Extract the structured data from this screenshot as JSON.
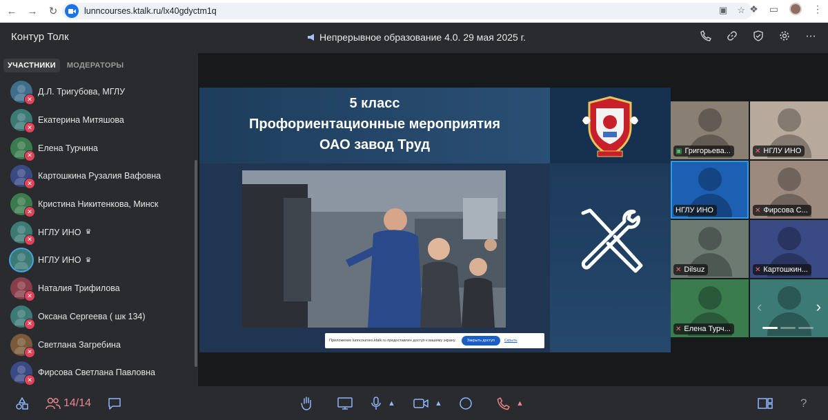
{
  "browser": {
    "url": "lunncourses.ktalk.ru/lx40gdyctm1q"
  },
  "app": {
    "title": "Контур Толк",
    "meeting_title": "Непрерывное образование 4.0. 29 мая 2025 г."
  },
  "sidebar": {
    "tabs": [
      {
        "label": "УЧАСТНИКИ",
        "active": true
      },
      {
        "label": "МОДЕРАТОРЫ",
        "active": false
      }
    ],
    "participants": [
      {
        "name": "Д.Л. Тригубова, МГЛУ",
        "color": "#3f6e8c",
        "muted": true,
        "moderator": false
      },
      {
        "name": "Екатерина Митяшова",
        "color": "#3c7a76",
        "muted": true,
        "moderator": false
      },
      {
        "name": "Елена Турчина",
        "color": "#3b7c4f",
        "muted": true,
        "moderator": false
      },
      {
        "name": "Картошкина Рузалия Вафовна",
        "color": "#3a4a85",
        "muted": true,
        "moderator": false
      },
      {
        "name": "Кристина Никитенкова, Минск",
        "color": "#3b7c4f",
        "muted": true,
        "moderator": false
      },
      {
        "name": "НГЛУ ИНО",
        "color": "#3c7a76",
        "muted": true,
        "moderator": true
      },
      {
        "name": "НГЛУ ИНО",
        "color": "#3c7a76",
        "muted": false,
        "moderator": true,
        "selected": true
      },
      {
        "name": "Наталия Трифилова",
        "color": "#8a3d4a",
        "muted": true,
        "moderator": false
      },
      {
        "name": "Оксана Сергеева ( шк 134)",
        "color": "#3c7a76",
        "muted": true,
        "moderator": false
      },
      {
        "name": "Светлана Загребина",
        "color": "#7a5a3a",
        "muted": true,
        "moderator": false
      },
      {
        "name": "Фирсова Светлана Павловна",
        "color": "#3a4a85",
        "muted": true,
        "moderator": false
      }
    ]
  },
  "slide": {
    "title_lines": [
      "5 класс",
      "Профориентационные мероприятия",
      "ОАО завод Труд"
    ],
    "notification": {
      "text": "Приложение lunncourses.ktalk.ru предоставлен доступ к вашему экрану.",
      "button": "Закрыть доступ",
      "link": "Скрыть"
    }
  },
  "tiles": [
    {
      "label": "Григорьева...",
      "bg": "#8a7f73",
      "indicator": "camera"
    },
    {
      "label": "НГЛУ ИНО",
      "bg": "#b7aa9d",
      "indicator": "muted"
    },
    {
      "label": "НГЛУ ИНО",
      "bg": "#1c5fb3",
      "indicator": "none",
      "active": true
    },
    {
      "label": "Фирсова С...",
      "bg": "#9c8a7e",
      "indicator": "muted"
    },
    {
      "label": "Dilsuz",
      "bg": "#6c7a72",
      "indicator": "muted"
    },
    {
      "label": "Картошкин...",
      "bg": "#3a4a85",
      "indicator": "muted"
    },
    {
      "label": "Елена Турч...",
      "bg": "#3b7c4f",
      "indicator": "muted"
    },
    {
      "label": "",
      "bg": "#3c7a76",
      "indicator": "pager"
    }
  ],
  "toolbar": {
    "participants_count": "14/14",
    "icons": [
      "apps-icon",
      "participants-icon",
      "chat-icon",
      "raise-hand-icon",
      "screen-share-icon",
      "microphone-icon",
      "camera-icon",
      "record-icon",
      "hangup-icon",
      "layout-icon",
      "help-icon"
    ],
    "help_label": "?"
  },
  "colors": {
    "accent": "#8fb8ff",
    "danger": "#e9868f",
    "mute_badge": "#e0445a"
  }
}
